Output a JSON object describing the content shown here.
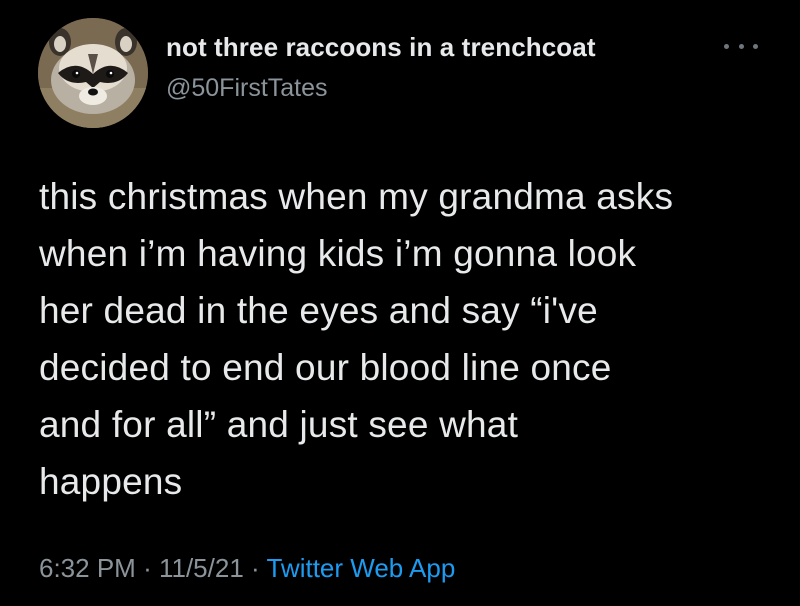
{
  "author": {
    "display_name": "not three raccoons in a trenchcoat",
    "handle": "@50FirstTates",
    "avatar_icon": "raccoon-avatar"
  },
  "more_icon": "more-horizontal-icon",
  "tweet": {
    "lines": [
      "this christmas when my grandma asks",
      "when i’m having kids i’m gonna look",
      "her dead in the eyes and say “i've",
      "decided to end our blood line once",
      "and for all” and just see what",
      "happens"
    ]
  },
  "meta": {
    "time": "6:32 PM",
    "separator": "·",
    "date": "11/5/21",
    "source": "Twitter Web App"
  },
  "colors": {
    "background": "#000000",
    "text": "#e7e9ea",
    "secondary": "#8b949a",
    "link": "#1d9bf0"
  }
}
